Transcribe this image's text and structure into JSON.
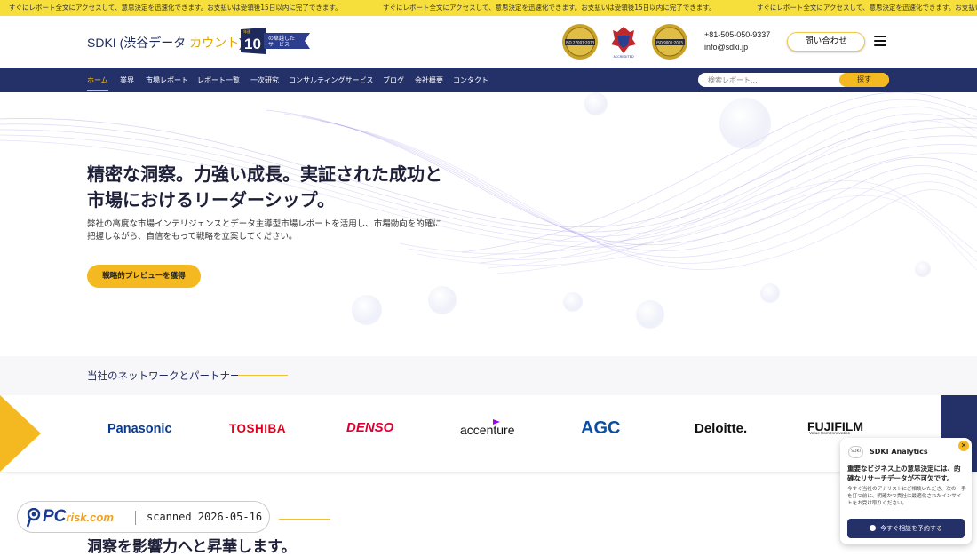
{
  "ticker": {
    "items": [
      "すぐにレポート全文にアクセスして、意思決定を迅速化できます。お支払いは受領後15日以内に完了できます。",
      "すぐにレポート全文にアクセスして、意思決定を迅速化できます。お支払いは受領後15日以内に完了できます。",
      "すぐにレポート全文にアクセスして、意思決定を迅速化できます。お支払いは受領後15日以内に完了できます。"
    ]
  },
  "header": {
    "logo_main": "SDKI (渋谷データ ",
    "logo_accent": "カウント",
    "logo_end": ")",
    "award_number": "10",
    "award_small": "年連",
    "award_line1": "の卓越した",
    "award_line2": "サービス",
    "badges": [
      "ISO 27001:2013",
      "ACCREDITED",
      "ISO 9001:2015"
    ],
    "phone": "+81-505-050-9337",
    "email": "info@sdki.jp",
    "inquiry_label": "問い合わせ"
  },
  "nav": {
    "items": [
      "ホーム",
      "業界",
      "市場レポート",
      "レポート一覧",
      "一次研究",
      "コンサルティングサービス",
      "ブログ",
      "会社概要",
      "コンタクト"
    ],
    "search_placeholder": "検索レポート...",
    "search_button": "探す"
  },
  "hero": {
    "title": "精密な洞察。力強い成長。実証された成功と市場におけるリーダーシップ。",
    "description": "弊社の高度な市場インテリジェンスとデータ主導型市場レポートを活用し、市場動向を的確に把握しながら、自信をもって戦略を立案してください。",
    "cta": "戦略的プレビューを獲得"
  },
  "partners": {
    "title": "当社のネットワークとパートナー",
    "logos": [
      {
        "name": "Panasonic",
        "color": "#0a3a8c"
      },
      {
        "name": "TOSHIBA",
        "color": "#e0001b"
      },
      {
        "name": "DENSO",
        "color": "#dc0032"
      },
      {
        "name": "accenture",
        "color": "#111111"
      },
      {
        "name": "AGC",
        "color": "#0b4ea2"
      },
      {
        "name": "Deloitte.",
        "color": "#111111"
      },
      {
        "name": "FUJIFILM",
        "color": "#111111",
        "sub": "Value from Innovation"
      }
    ]
  },
  "lower": {
    "title": "洞察を影響力へと昇華します。"
  },
  "watermark": {
    "brand": "PC",
    "brand_suffix": "risk.com",
    "text": "scanned 2026-05-16"
  },
  "chat": {
    "avatar": "SDKI",
    "title": "SDKI Analytics",
    "heading": "重要なビジネス上の意思決定には、的確なリサーチデータが不可欠です。",
    "body": "今すぐ当社のアナリストにご相談いただき、次の一手を打つ前に、明確かつ貴社に最適化されたインサイトをお受け取りください。",
    "button": "今すぐ相談を予約する",
    "close": "✕"
  },
  "colors": {
    "ticker": "#f6df3b",
    "nav": "#243068",
    "accent": "#f4b920"
  }
}
